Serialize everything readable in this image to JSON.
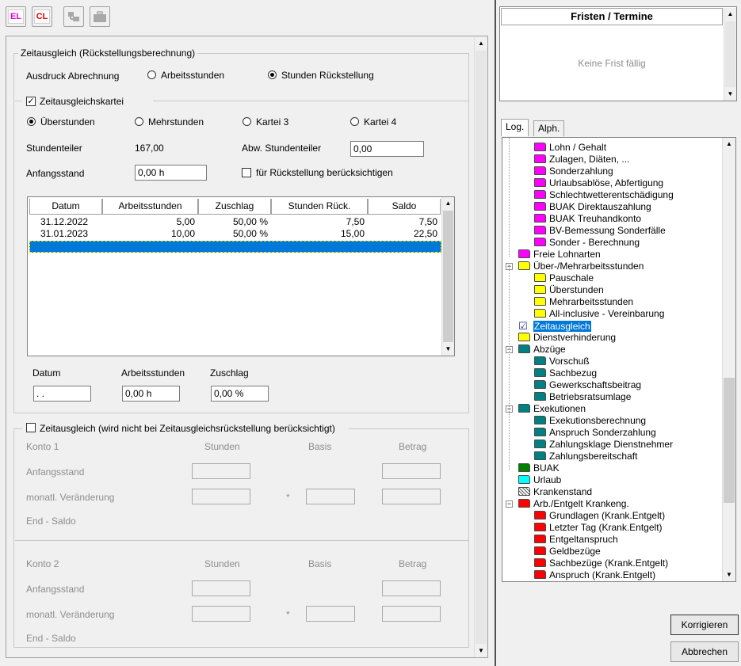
{
  "toolbar": {
    "el_label": "EL",
    "cl_label": "CL"
  },
  "colors": {
    "accent": "#0078d7",
    "magenta": "#ff00ff",
    "yellow": "#ffff00",
    "teal": "#008080",
    "green": "#008000",
    "cyan": "#00ffff",
    "red": "#ff0000"
  },
  "rueck": {
    "title": "Zeitausgleich (Rückstellungsberechnung)",
    "ausdruck_label": "Ausdruck Abrechnung",
    "opt_arbeitsstunden": "Arbeitsstunden",
    "opt_stunden_rueck": "Stunden Rückstellung"
  },
  "kartei": {
    "title": "Zeitausgleichskartei",
    "opt_ueberstunden": "Überstunden",
    "opt_mehrstunden": "Mehrstunden",
    "opt_kartei3": "Kartei 3",
    "opt_kartei4": "Kartei 4",
    "stundenteiler_label": "Stundenteiler",
    "stundenteiler_value": "167,00",
    "abw_label": "Abw. Stundenteiler",
    "abw_value": "0,00",
    "anfangsstand_label": "Anfangsstand",
    "anfangsstand_value": "0,00  h",
    "fuer_rueck_label": "für Rückstellung berücksichtigen"
  },
  "grid": {
    "headers": [
      "Datum",
      "Arbeitsstunden",
      "Zuschlag",
      "Stunden Rück.",
      "Saldo"
    ],
    "rows": [
      [
        "31.12.2022",
        "5,00",
        "50,00 %",
        "7,50",
        "7,50"
      ],
      [
        "31.01.2023",
        "10,00",
        "50,00 %",
        "15,00",
        "22,50"
      ]
    ]
  },
  "entry": {
    "datum_label": "Datum",
    "datum_value": " . .",
    "arbeitsstunden_label": "Arbeitsstunden",
    "arbeitsstunden_value": "0,00  h",
    "zuschlag_label": "Zuschlag",
    "zuschlag_value": "0,00  %"
  },
  "za": {
    "title": "Zeitausgleich (wird nicht bei Zeitausgleichsrückstellung berücksichtigt)",
    "konto1": "Konto 1",
    "konto2": "Konto 2",
    "stunden": "Stunden",
    "basis": "Basis",
    "betrag": "Betrag",
    "anfangsstand": "Anfangsstand",
    "veraenderung": "monatl. Veränderung",
    "end_saldo": "End - Saldo",
    "mult": "*"
  },
  "fristen": {
    "title": "Fristen / Termine",
    "empty": "Keine Frist fällig"
  },
  "tabs": {
    "log": "Log.",
    "alph": "Alph."
  },
  "tree": [
    {
      "label": "Lohn / Gehalt",
      "color": "#ff00ff"
    },
    {
      "label": "Zulagen, Diäten, ...",
      "color": "#ff00ff"
    },
    {
      "label": "Sonderzahlung",
      "color": "#ff00ff"
    },
    {
      "label": "Urlaubsablöse, Abfertigung",
      "color": "#ff00ff"
    },
    {
      "label": "Schlechtwetterentschädigung",
      "color": "#ff00ff"
    },
    {
      "label": "BUAK Direktauszahlung",
      "color": "#ff00ff"
    },
    {
      "label": "BUAK Treuhandkonto",
      "color": "#ff00ff"
    },
    {
      "label": "BV-Bemessung Sonderfälle",
      "color": "#ff00ff"
    },
    {
      "label": "Sonder - Berechnung",
      "color": "#ff00ff"
    },
    {
      "label": "Freie Lohnarten",
      "color": "#ff00ff"
    },
    {
      "label": "Über-/Mehrarbeitsstunden",
      "color": "#ffff00"
    },
    {
      "label": "Pauschale",
      "color": "#ffff00"
    },
    {
      "label": "Überstunden",
      "color": "#ffff00"
    },
    {
      "label": "Mehrarbeitsstunden",
      "color": "#ffff00"
    },
    {
      "label": "All-inclusive - Vereinbarung",
      "color": "#ffff00"
    },
    {
      "label": "Zeitausgleich",
      "color": "check"
    },
    {
      "label": "Dienstverhinderung",
      "color": "#ffff00"
    },
    {
      "label": "Abzüge",
      "color": "#008080"
    },
    {
      "label": "Vorschuß",
      "color": "#008080"
    },
    {
      "label": "Sachbezug",
      "color": "#008080"
    },
    {
      "label": "Gewerkschaftsbeitrag",
      "color": "#008080"
    },
    {
      "label": "Betriebsratsumlage",
      "color": "#008080"
    },
    {
      "label": "Exekutionen",
      "color": "#008080"
    },
    {
      "label": "Exekutionsberechnung",
      "color": "#008080"
    },
    {
      "label": "Anspruch Sonderzahlung",
      "color": "#008080"
    },
    {
      "label": "Zahlungsklage Dienstnehmer",
      "color": "#008080"
    },
    {
      "label": "Zahlungsbereitschaft",
      "color": "#008080"
    },
    {
      "label": "BUAK",
      "color": "#008000"
    },
    {
      "label": "Urlaub",
      "color": "#00ffff"
    },
    {
      "label": "Krankenstand",
      "color": "hatch"
    },
    {
      "label": "Arb./Entgelt Krankeng.",
      "color": "#ff0000"
    },
    {
      "label": "Grundlagen (Krank.Entgelt)",
      "color": "#ff0000"
    },
    {
      "label": "Letzter Tag (Krank.Entgelt)",
      "color": "#ff0000"
    },
    {
      "label": "Entgeltanspruch",
      "color": "#ff0000"
    },
    {
      "label": "Geldbezüge",
      "color": "#ff0000"
    },
    {
      "label": "Sachbezüge (Krank.Entgelt)",
      "color": "#ff0000"
    },
    {
      "label": "Anspruch (Krank.Entgelt)",
      "color": "#ff0000"
    }
  ],
  "buttons": {
    "korrigieren": "Korrigieren",
    "abbrechen": "Abbrechen"
  }
}
